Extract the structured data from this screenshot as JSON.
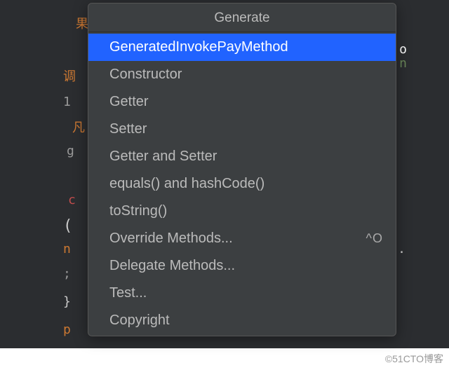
{
  "editor": {
    "fragments": {
      "f1": "果",
      "f2": "调",
      "f3": "1",
      "f4": "凡",
      "f5": "g",
      "f6": "c",
      "f7": "(",
      "f8": "n",
      "f9": ";",
      "f10": "}",
      "f11": "p",
      "r1": "o",
      "r2": "n",
      "r3": "."
    }
  },
  "popup": {
    "title": "Generate",
    "items": [
      {
        "label": "GeneratedInvokePayMethod",
        "shortcut": "",
        "selected": true
      },
      {
        "label": "Constructor",
        "shortcut": "",
        "selected": false
      },
      {
        "label": "Getter",
        "shortcut": "",
        "selected": false
      },
      {
        "label": "Setter",
        "shortcut": "",
        "selected": false
      },
      {
        "label": "Getter and Setter",
        "shortcut": "",
        "selected": false
      },
      {
        "label": "equals() and hashCode()",
        "shortcut": "",
        "selected": false
      },
      {
        "label": "toString()",
        "shortcut": "",
        "selected": false
      },
      {
        "label": "Override Methods...",
        "shortcut": "^O",
        "selected": false
      },
      {
        "label": "Delegate Methods...",
        "shortcut": "",
        "selected": false
      },
      {
        "label": "Test...",
        "shortcut": "",
        "selected": false
      },
      {
        "label": "Copyright",
        "shortcut": "",
        "selected": false
      }
    ]
  },
  "watermark": "©51CTO博客"
}
